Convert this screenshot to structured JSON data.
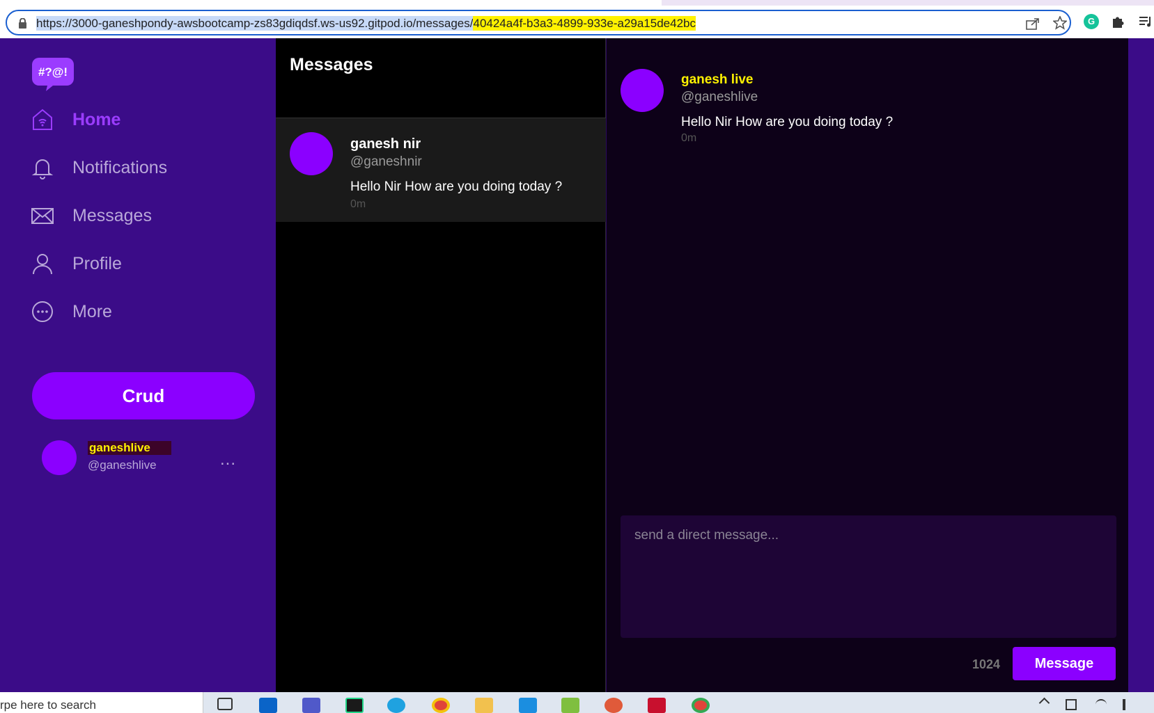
{
  "browser": {
    "url_base": "https://3000-ganeshpondy-awsbootcamp-zs83gdiqdsf.ws-us92.gitpod.io/messages/",
    "url_id": "40424a4f-b3a3-4899-933e-a29a15de42bc",
    "icons": [
      "lock-icon",
      "share-icon",
      "star-icon",
      "grammarly-icon",
      "puzzle-icon",
      "reading-list-icon"
    ],
    "ext_g_label": "G"
  },
  "sidebar": {
    "logo_text": "#?@!",
    "items": [
      {
        "label": "Home",
        "icon": "home-icon",
        "active": true
      },
      {
        "label": "Notifications",
        "icon": "bell-icon",
        "active": false
      },
      {
        "label": "Messages",
        "icon": "envelope-icon",
        "active": false
      },
      {
        "label": "Profile",
        "icon": "person-icon",
        "active": false
      },
      {
        "label": "More",
        "icon": "more-circle-icon",
        "active": false
      }
    ],
    "crud_label": "Crud",
    "profile": {
      "display_name": "ganeshlive",
      "handle": "@ganeshlive",
      "more": "..."
    }
  },
  "groups": {
    "title": "Messages",
    "items": [
      {
        "name": "ganesh nir",
        "handle": "@ganeshnir",
        "message": "Hello Nir How are you doing today ?",
        "time": "0m"
      }
    ]
  },
  "conversation": {
    "messages": [
      {
        "name": "ganesh live",
        "handle": "@ganeshlive",
        "message": "Hello Nir How are you doing today ?",
        "time": "0m"
      }
    ],
    "composer_placeholder": "send a direct message...",
    "char_count": "1024",
    "send_label": "Message"
  },
  "taskbar": {
    "search_text": "rpe here to search"
  },
  "colors": {
    "accent": "#8b00ff",
    "sidebar_bg": "#3b0c88",
    "highlight": "#fff200"
  }
}
